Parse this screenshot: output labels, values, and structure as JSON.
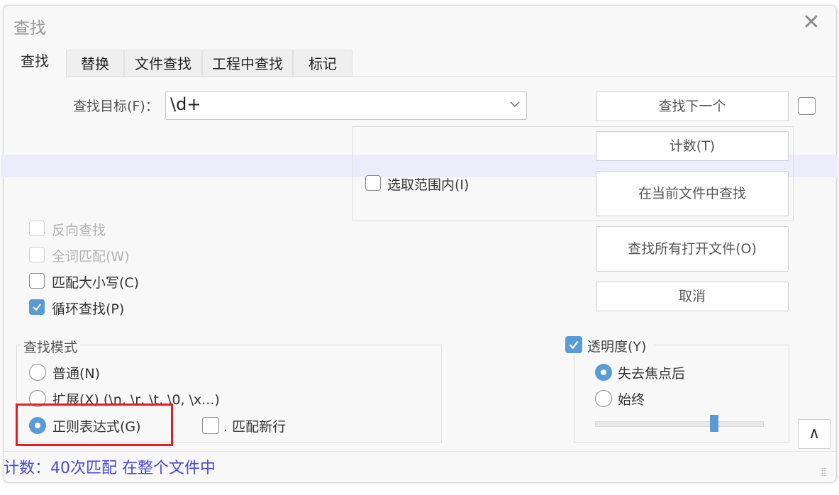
{
  "window": {
    "title": "查找",
    "close_icon": "close-icon"
  },
  "tabs": [
    {
      "label": "查找",
      "active": true
    },
    {
      "label": "替换"
    },
    {
      "label": "文件查找"
    },
    {
      "label": "工程中查找"
    },
    {
      "label": "标记"
    }
  ],
  "search": {
    "label": "查找目标(F)：",
    "value": "\\d+"
  },
  "buttons": {
    "find_next": "查找下一个",
    "count": "计数(T)",
    "find_in_current": "在当前文件中查找",
    "find_in_all_open": "查找所有打开文件(O)",
    "cancel": "取消",
    "up_arrow": "∧"
  },
  "options": {
    "in_selection": "选取范围内(I)",
    "backward": "反向查找",
    "whole_word": "全词匹配(W)",
    "match_case": "匹配大小写(C)",
    "wrap_around": "循环查找(P)"
  },
  "search_mode": {
    "title": "查找模式",
    "normal": "普通(N)",
    "extended": "扩展(X) (\\n, \\r, \\t, \\0, \\x...)",
    "regex": "正则表达式(G)",
    "dot_matches_newline": ". 匹配新行",
    "selected": "regex"
  },
  "transparency": {
    "title": "透明度(Y)",
    "enabled": true,
    "on_lose_focus": "失去焦点后",
    "always": "始终",
    "selected": "on_lose_focus",
    "level": 0.7
  },
  "status": {
    "text": "计数：40次匹配 在整个文件中"
  },
  "colors": {
    "accent": "#5b9bd5",
    "status_text": "#4a4ad0",
    "highlight_box": "#e02020"
  }
}
